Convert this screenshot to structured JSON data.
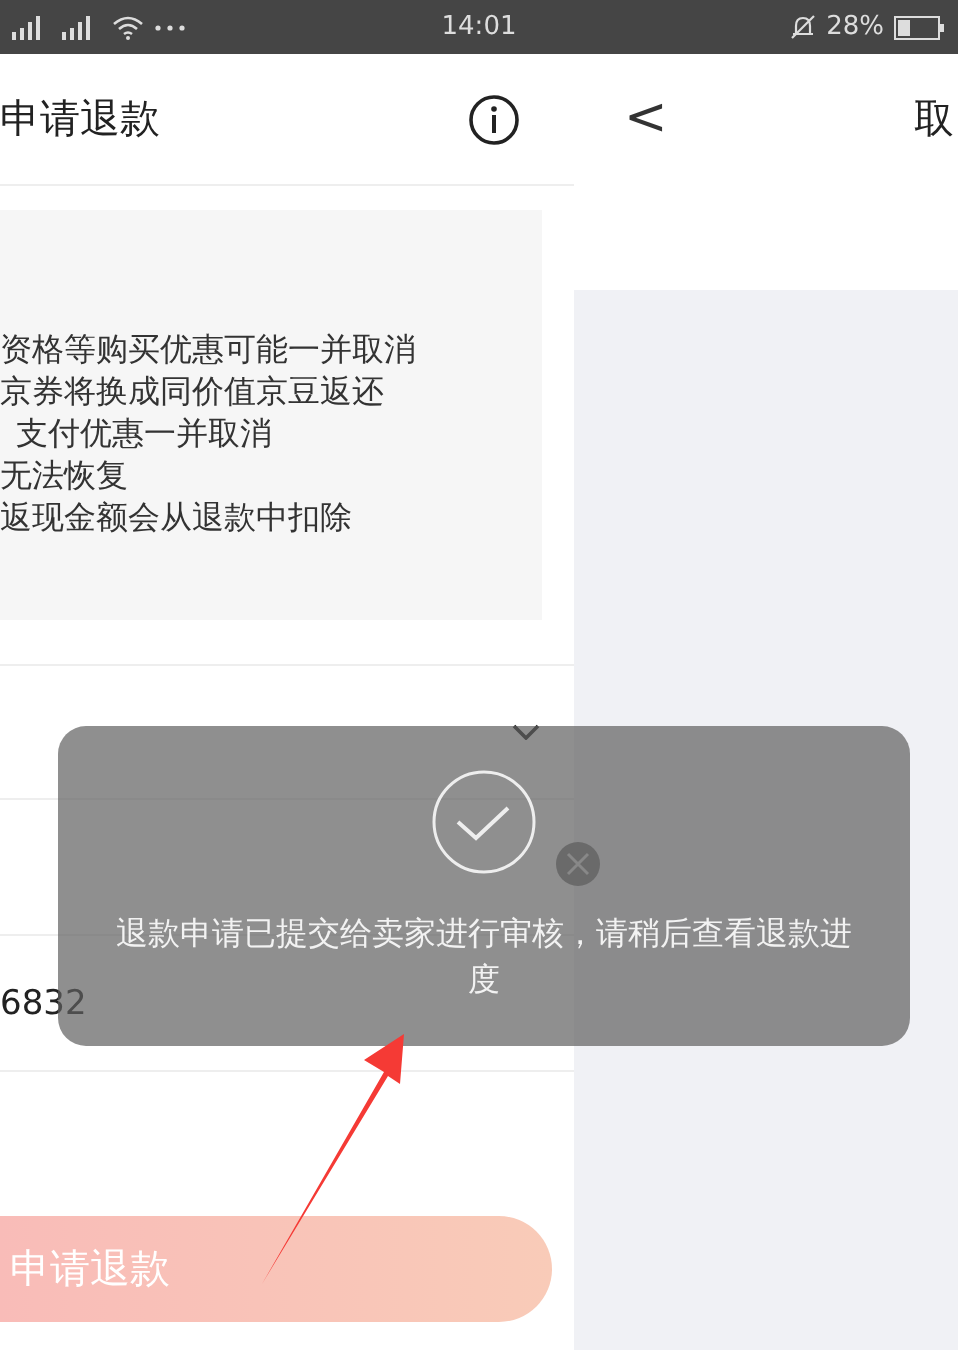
{
  "status_bar": {
    "time": "14:01",
    "battery_percent": "28%"
  },
  "left_panel": {
    "title": "申请退款",
    "notice_lines": [
      "资格等购买优惠可能一并取消",
      "京券将换成同价值京豆返还",
      "支付优惠一并取消",
      "无法恢复",
      "返现金额会从退款中扣除"
    ],
    "field_value": "6832",
    "submit_label": "申请退款"
  },
  "right_panel": {
    "back": "<",
    "title": "取"
  },
  "toast": {
    "message": "退款申请已提交给卖家进行审核，请稍后查看退款进度"
  }
}
